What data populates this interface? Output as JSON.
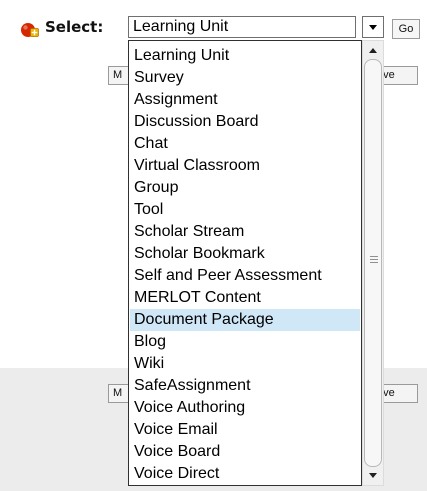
{
  "toolbar": {
    "add_icon": "add-content-icon",
    "select_label": "Select:",
    "current_selection": "Learning Unit",
    "go_label": "Go"
  },
  "hidden_buttons": {
    "top_left_label": "M",
    "top_right_label": "ove",
    "bottom_left_label": "M",
    "bottom_right_label": "ove"
  },
  "dropdown": {
    "selected_option": "Document Package",
    "options": [
      "Learning Unit",
      "Survey",
      "Assignment",
      "Discussion Board",
      "Chat",
      "Virtual Classroom",
      "Group",
      "Tool",
      "Scholar Stream",
      "Scholar Bookmark",
      "Self and Peer Assessment",
      "MERLOT Content",
      "Document Package",
      "Blog",
      "Wiki",
      "SafeAssignment",
      "Voice Authoring",
      "Voice Email",
      "Voice Board",
      "Voice Direct"
    ]
  },
  "colors": {
    "selected_row": "#cfe7f7",
    "grey_band": "#ececec",
    "icon_red": "#d62800"
  }
}
